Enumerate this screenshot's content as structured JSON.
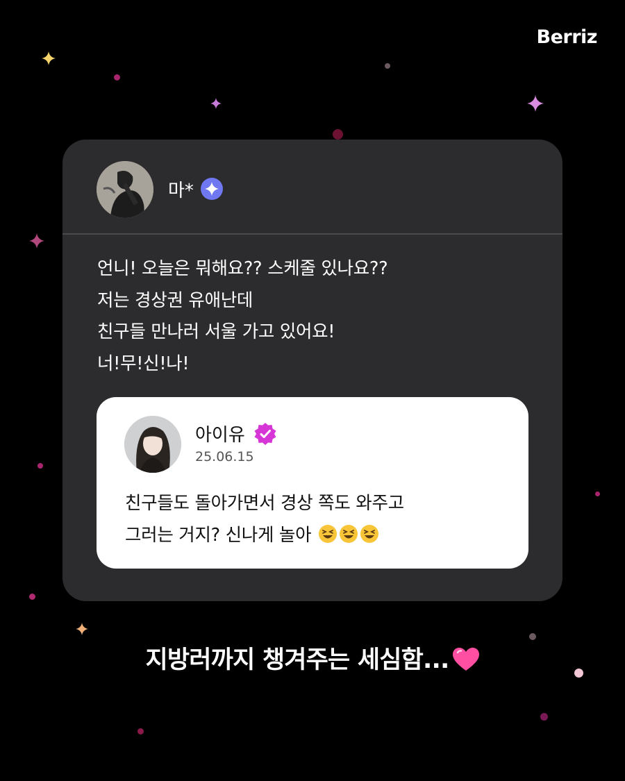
{
  "brand": {
    "logo_text": "Berriz"
  },
  "post": {
    "fan_name": "마*",
    "fan_badge_icon": "sparkle-badge-icon",
    "message_lines": [
      "언니! 오늘은 뭐해요?? 스케줄 있나요??",
      "저는 경상권 유애난데",
      "친구들 만나러 서울 가고 있어요!",
      "너!무!신!나!"
    ]
  },
  "reply": {
    "artist_name": "아이유",
    "verified_icon": "verified-check-icon",
    "date": "25.06.15",
    "text_lines": [
      "친구들도 돌아가면서 경상 쪽도 와주고",
      "그러는 거지? 신나게 놀아"
    ],
    "emoji_icon": "grinning-squinting-face-icon"
  },
  "caption": {
    "text": "지방러까지 챙겨주는 세심함..."
  },
  "colors": {
    "background": "#000000",
    "card": "#2c2c2e",
    "reply_card": "#ffffff",
    "fan_badge": "#6f78f0",
    "verified_badge": "#d636d6",
    "heart": "#ff4fa3"
  }
}
